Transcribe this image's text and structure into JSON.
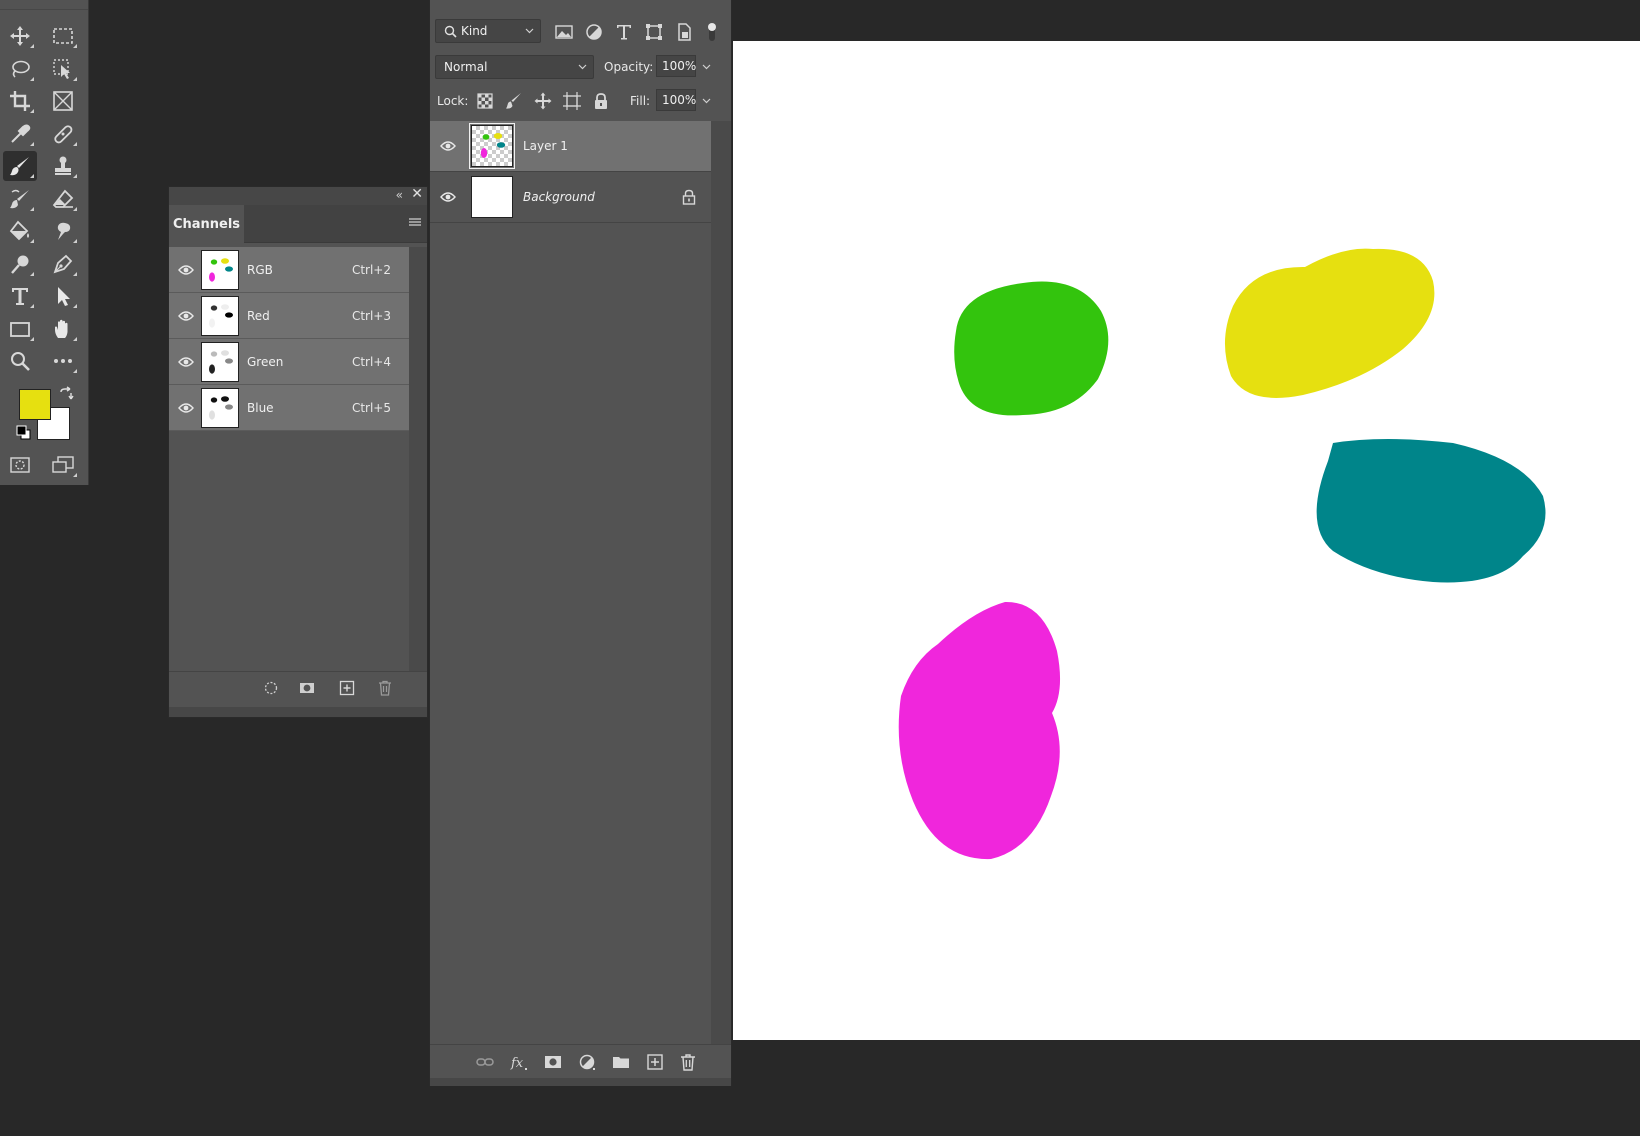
{
  "colors": {
    "foreground": "#e6e010",
    "background": "#ffffff",
    "green_blob": "#33c40d",
    "yellow_blob": "#e6e010",
    "teal_blob": "#00858a",
    "magenta_blob": "#f026dc"
  },
  "toolbar": {
    "tools": [
      {
        "name": "move-tool",
        "icon": "move-icon"
      },
      {
        "name": "marquee-tool",
        "icon": "rect-marquee-icon"
      },
      {
        "name": "lasso-tool",
        "icon": "lasso-icon"
      },
      {
        "name": "object-select-tool",
        "icon": "object-select-icon"
      },
      {
        "name": "crop-tool",
        "icon": "crop-icon"
      },
      {
        "name": "frame-tool",
        "icon": "frame-icon"
      },
      {
        "name": "eyedropper-tool",
        "icon": "eyedropper-icon"
      },
      {
        "name": "healing-tool",
        "icon": "bandage-icon"
      },
      {
        "name": "brush-tool",
        "icon": "brush-icon"
      },
      {
        "name": "stamp-tool",
        "icon": "stamp-icon"
      },
      {
        "name": "history-brush-tool",
        "icon": "history-brush-icon"
      },
      {
        "name": "eraser-tool",
        "icon": "eraser-icon"
      },
      {
        "name": "paint-bucket-tool",
        "icon": "bucket-icon"
      },
      {
        "name": "smudge-tool",
        "icon": "smudge-icon"
      },
      {
        "name": "dodge-tool",
        "icon": "dodge-icon"
      },
      {
        "name": "pen-tool",
        "icon": "pen-icon"
      },
      {
        "name": "type-tool",
        "icon": "type-icon"
      },
      {
        "name": "path-select-tool",
        "icon": "arrow-icon"
      },
      {
        "name": "rectangle-tool",
        "icon": "rectangle-icon"
      },
      {
        "name": "hand-tool",
        "icon": "hand-icon"
      },
      {
        "name": "zoom-tool",
        "icon": "zoom-icon"
      },
      {
        "name": "more-tools",
        "icon": "ellipsis-icon"
      }
    ]
  },
  "channels": {
    "tab_label": "Channels",
    "items": [
      {
        "name": "RGB",
        "shortcut": "Ctrl+2"
      },
      {
        "name": "Red",
        "shortcut": "Ctrl+3"
      },
      {
        "name": "Green",
        "shortcut": "Ctrl+4"
      },
      {
        "name": "Blue",
        "shortcut": "Ctrl+5"
      }
    ]
  },
  "layers": {
    "filter_label": "Kind",
    "blend_mode": "Normal",
    "opacity_label": "Opacity:",
    "opacity_value": "100%",
    "lock_label": "Lock:",
    "fill_label": "Fill:",
    "fill_value": "100%",
    "items": [
      {
        "name": "Layer 1"
      },
      {
        "name": "Background"
      }
    ]
  }
}
